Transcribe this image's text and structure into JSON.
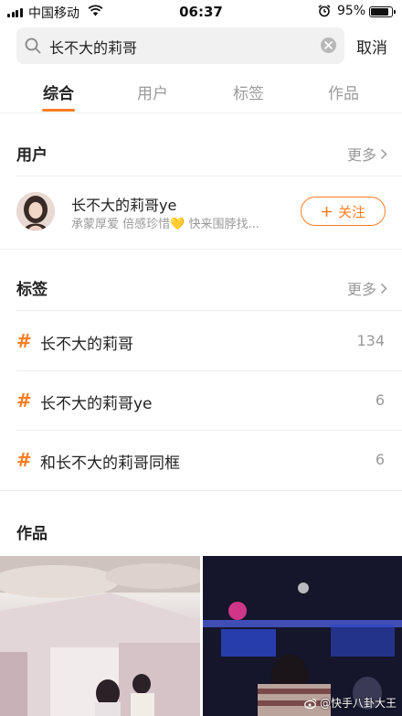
{
  "status_bar": {
    "carrier": "中国移动",
    "time": "06:37",
    "battery": "95%"
  },
  "search": {
    "query": "长不大的莉哥",
    "cancel_label": "取消"
  },
  "tabs": [
    {
      "label": "综合",
      "active": true
    },
    {
      "label": "用户",
      "active": false
    },
    {
      "label": "标签",
      "active": false
    },
    {
      "label": "作品",
      "active": false
    }
  ],
  "users_section": {
    "title": "用户",
    "more_label": "更多",
    "user": {
      "name": "长不大的莉哥ye",
      "description": "承蒙厚爱 倍感珍惜💛 快来围脖找...",
      "follow_label": "关注"
    }
  },
  "tags_section": {
    "title": "标签",
    "more_label": "更多",
    "tags": [
      {
        "name": "长不大的莉哥",
        "count": "134"
      },
      {
        "name": "长不大的莉哥ye",
        "count": "6"
      },
      {
        "name": "和长不大的莉哥同框",
        "count": "6"
      }
    ]
  },
  "works_section": {
    "title": "作品",
    "watermark": "@快手八卦大王"
  },
  "colors": {
    "accent": "#ff7d22",
    "muted": "#999999"
  }
}
